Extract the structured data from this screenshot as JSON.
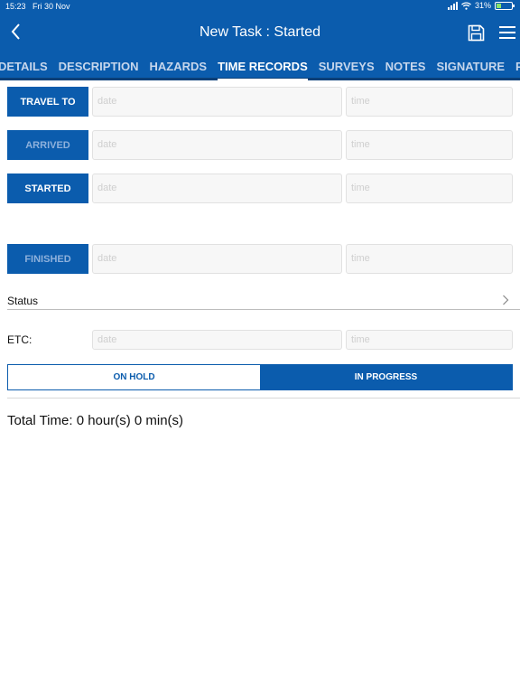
{
  "status_bar": {
    "time": "15:23",
    "date": "Fri 30 Nov",
    "battery": "31%",
    "battery_level": 0.31
  },
  "header": {
    "title": "New Task : Started",
    "icons": [
      "chevron-left-icon",
      "save-icon",
      "menu-icon"
    ]
  },
  "tabs": [
    {
      "label": "DETAILS",
      "active": false
    },
    {
      "label": "DESCRIPTION",
      "active": false
    },
    {
      "label": "HAZARDS",
      "active": false
    },
    {
      "label": "TIME RECORDS",
      "active": true
    },
    {
      "label": "SURVEYS",
      "active": false
    },
    {
      "label": "NOTES",
      "active": false
    },
    {
      "label": "SIGNATURE",
      "active": false
    },
    {
      "label": "PI",
      "active": false
    }
  ],
  "time_records": [
    {
      "button": "TRAVEL TO",
      "date_placeholder": "date",
      "time_placeholder": "time"
    },
    {
      "button": "ARRIVED",
      "date_placeholder": "date",
      "time_placeholder": "time"
    },
    {
      "button": "STARTED",
      "date_placeholder": "date",
      "time_placeholder": "time"
    },
    {
      "button": "FINISHED",
      "date_placeholder": "date",
      "time_placeholder": "time"
    }
  ],
  "status": {
    "label": "Status"
  },
  "etc": {
    "label": "ETC:",
    "date_placeholder": "date",
    "time_placeholder": "time"
  },
  "segment": {
    "on_hold": "ON HOLD",
    "in_progress": "IN PROGRESS",
    "selected": "IN PROGRESS"
  },
  "total_time": "Total Time:  0 hour(s) 0 min(s)",
  "colors": {
    "primary": "#0b5cad",
    "tab_underline_bar": "#0a3f78",
    "field_bg": "#f7f7f7"
  }
}
